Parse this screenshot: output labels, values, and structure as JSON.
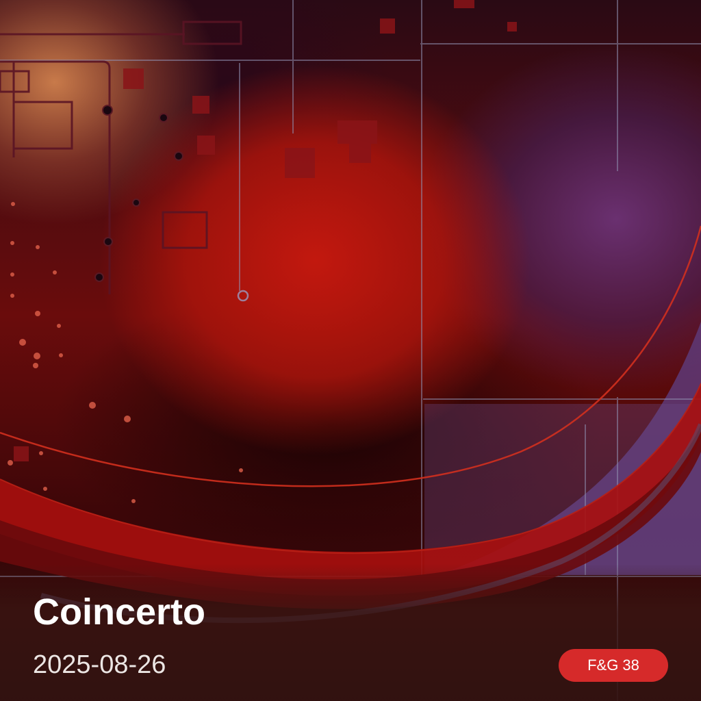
{
  "title": "Coincerto",
  "date": "2025-08-26",
  "badge": {
    "label": "F&G 38",
    "color": "#d62a2a"
  },
  "colors": {
    "text": "#ffffff",
    "background_accent": "#c2180e"
  }
}
